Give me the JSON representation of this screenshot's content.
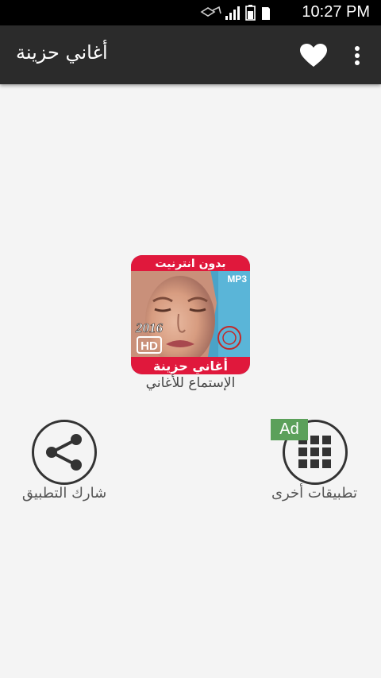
{
  "status_bar": {
    "time": "10:27 PM",
    "icons": [
      "notification-icon",
      "signal-icon",
      "battery-icon",
      "sd-card-icon"
    ]
  },
  "app_bar": {
    "title": "أغاني حزينة",
    "favorite_icon": "heart-icon",
    "menu_icon": "overflow-menu-icon"
  },
  "main": {
    "listen_label": "الإستماع للأغاني",
    "cover": {
      "top_text": "بدون انترنيت",
      "format": "MP3",
      "year": "2016",
      "quality": "HD",
      "bottom_text": "أغاني حزينة"
    },
    "share_label": "شارك التطبيق",
    "other_apps_label": "تطبيقات أخرى",
    "ad_badge": "Ad"
  },
  "colors": {
    "app_bar": "#2b2b2b",
    "background": "#f4f4f4",
    "cover_red": "#e0183c",
    "ad_green": "#5ba05a"
  }
}
